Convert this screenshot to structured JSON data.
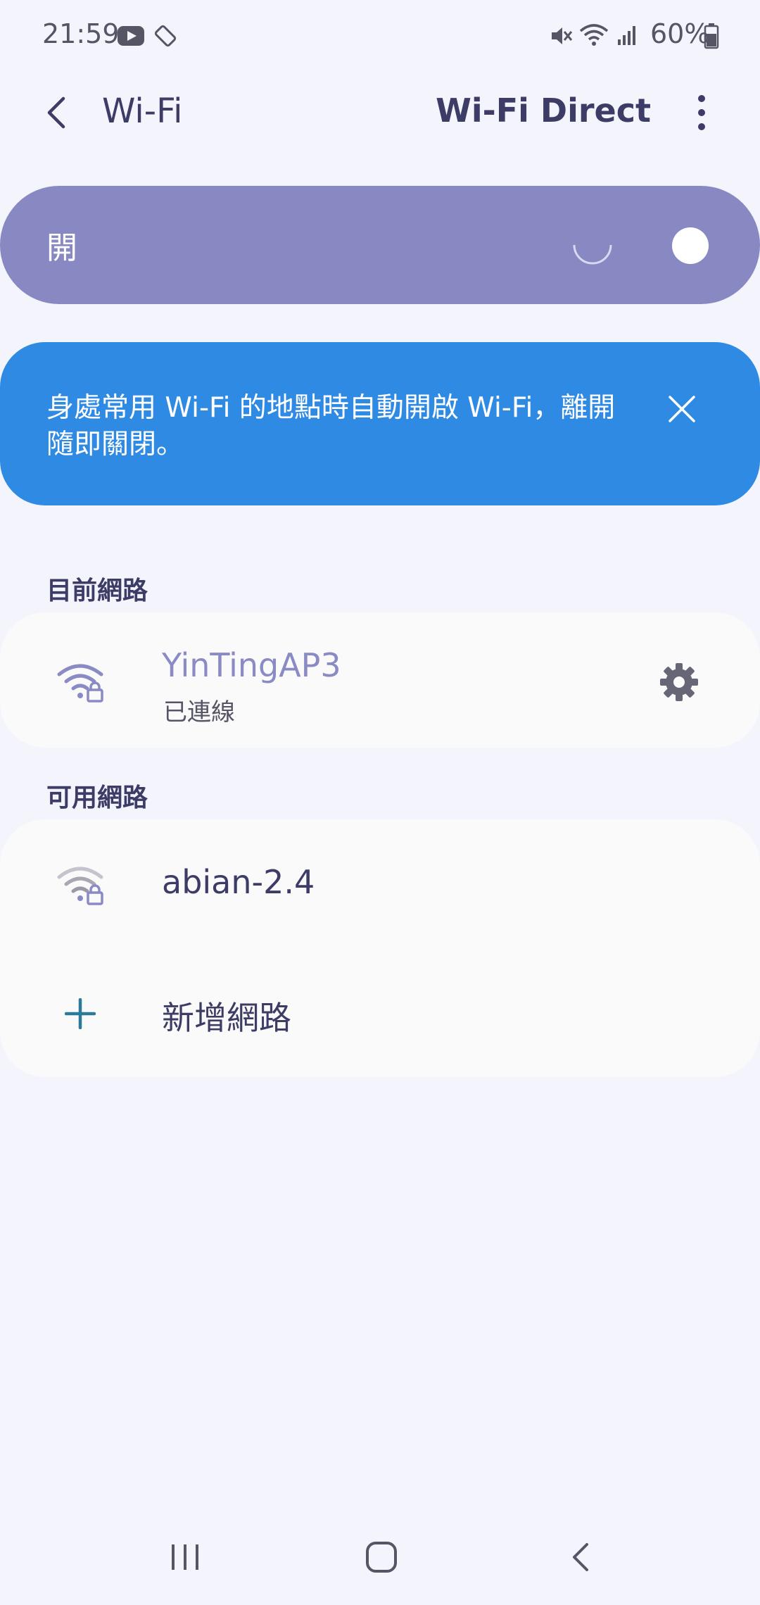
{
  "status_bar": {
    "time": "21:59",
    "battery": "60%",
    "icons": [
      "youtube-icon",
      "auto-rotate-icon",
      "mute-icon",
      "wifi-icon",
      "signal-icon",
      "battery-icon"
    ]
  },
  "app_bar": {
    "title": "Wi-Fi",
    "wifi_direct": "Wi-Fi Direct"
  },
  "toggle": {
    "label": "開",
    "state": "on"
  },
  "banner": {
    "text": "身處常用 Wi-Fi 的地點時自動開啟 Wi-Fi，離開隨即關閉。"
  },
  "current_section": {
    "header": "目前網路",
    "network": {
      "name": "YinTingAP3",
      "status": "已連線"
    }
  },
  "available_section": {
    "header": "可用網路",
    "networks": [
      {
        "name": "abian-2.4"
      }
    ],
    "add_network_label": "新增網路"
  },
  "colors": {
    "background": "#f3f4fc",
    "toggle_card": "#8888c2",
    "banner": "#2f8ae4",
    "connected_name": "#8a8ac4",
    "add_icon": "#2b7a9a"
  }
}
